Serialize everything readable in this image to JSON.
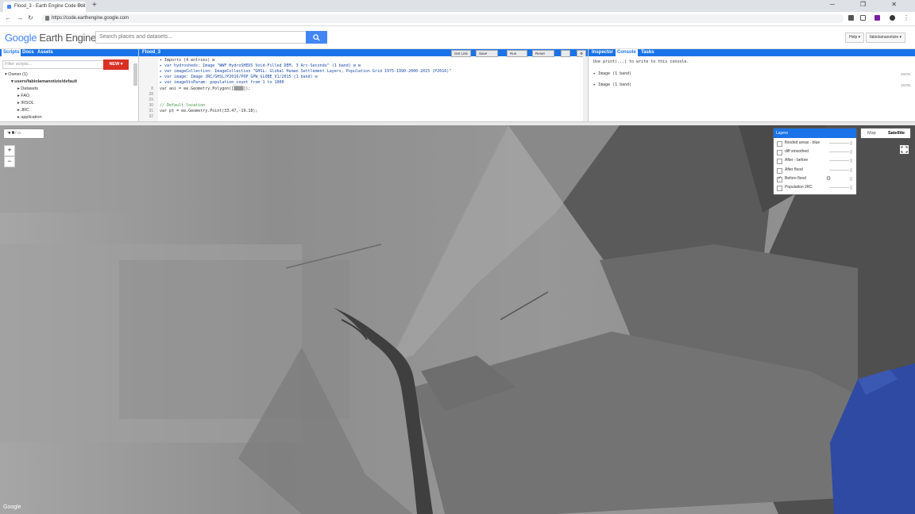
{
  "browser": {
    "tab_title": "Flood_3 - Earth Engine Code Edit",
    "tab_close": "×",
    "new_tab": "+",
    "window_controls": "─ ❐ ✕",
    "url": "https://code.earthengine.google.com"
  },
  "header": {
    "logo_google": "Google",
    "logo_ee": " Earth Engine",
    "search_placeholder": "Search places and datasets...",
    "help": "Help ▾",
    "user": "fabiolamanotizie ▾"
  },
  "left_panel": {
    "tabs": [
      "Scripts",
      "Docs",
      "Assets"
    ],
    "filter_placeholder": "Filter scripts...",
    "new_button": "NEW ▾",
    "tree": [
      {
        "label": "▾ Owner (1)",
        "indent": 0
      },
      {
        "label": "▾ users/fabiolamanotizie/default",
        "indent": 1
      },
      {
        "label": "▸ Datasets",
        "indent": 2
      },
      {
        "label": "▸ FAO",
        "indent": 2
      },
      {
        "label": "▸ IRSOL",
        "indent": 2
      },
      {
        "label": "▸ JRC",
        "indent": 2
      },
      {
        "label": "▸ application",
        "indent": 2
      }
    ]
  },
  "editor": {
    "title": "Flood_3",
    "toolbar": [
      "Get Link",
      "Save",
      "Run",
      "Reset"
    ],
    "lines": [
      {
        "n": "",
        "text": "▾ Imports (4 entries) ⊟"
      },
      {
        "n": "",
        "text": "  ▸ var hydrosheds: Image \"WWF HydroSHEDS Void-Filled DEM, 3 Arc-Seconds\" (1 band) ⊟ ⊟"
      },
      {
        "n": "",
        "text": "  ▸ var imageCollection: ImageCollection \"GHSL: Global Human Settlement Layers, Population Grid 1975-1990-2000-2015 (P2016)\""
      },
      {
        "n": "",
        "text": "  ▸ var image: Image JRC/GHSL/P2016/POP_GPW_GLOBE_V1/2015 (1 band) ⊟"
      },
      {
        "n": "",
        "text": "  ▸ var imageVisParam: population_count from 1 to 1000"
      },
      {
        "n": "8",
        "text": "var aoi = ee.Geometry.Polygon([▒▒▒▒]);"
      },
      {
        "n": "28",
        "text": ""
      },
      {
        "n": "29",
        "text": ""
      },
      {
        "n": "30",
        "text": "  // Default location"
      },
      {
        "n": "31",
        "text": "var pt = ee.Geometry.Point(33.47,-19.18);"
      },
      {
        "n": "32",
        "text": ""
      }
    ]
  },
  "right_panel": {
    "tabs": [
      "Inspector",
      "Console",
      "Tasks"
    ],
    "hint": "Use print(...) to write to this console.",
    "items": [
      {
        "label": "▸ Image (1 band)",
        "json": "JSON"
      },
      {
        "label": "▸ Image (1 band)",
        "json": "JSON"
      }
    ]
  },
  "map": {
    "tools": "☚ ⬮ ⁄ ▭",
    "zoom_in": "+",
    "zoom_out": "−",
    "layers_title": "Layers",
    "layers": [
      {
        "label": "flooded areas - blue",
        "checked": false
      },
      {
        "label": "diff smoothed",
        "checked": false
      },
      {
        "label": "After - before",
        "checked": false
      },
      {
        "label": "After flood",
        "checked": false
      },
      {
        "label": "Before flood",
        "checked": true
      },
      {
        "label": "Population JRC",
        "checked": false
      }
    ],
    "map_type": [
      "Map",
      "Satellite"
    ],
    "attribution": "Google",
    "accent": "#1a73e8"
  }
}
